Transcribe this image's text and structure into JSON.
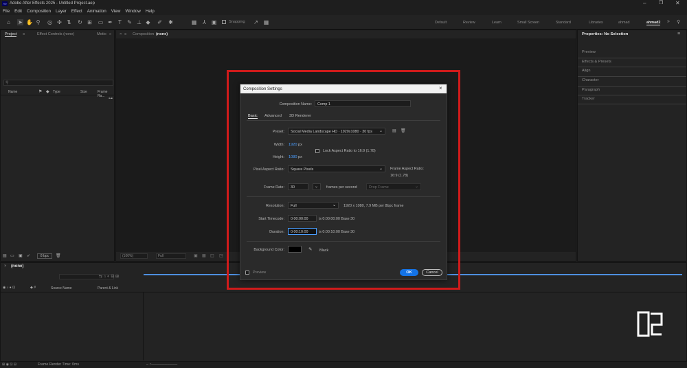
{
  "app": {
    "title": "Adobe After Effects 2025 - Untitled Project.aep",
    "logo": "Ae"
  },
  "menu": [
    "File",
    "Edit",
    "Composition",
    "Layer",
    "Effect",
    "Animation",
    "View",
    "Window",
    "Help"
  ],
  "toolbar": {
    "snapping": "Snapping"
  },
  "workspaces": [
    "Default",
    "Review",
    "Learn",
    "Small Screen",
    "Standard",
    "Libraries",
    "ahmad",
    "ahmad2"
  ],
  "project_panel": {
    "tab_project": "Project",
    "tab_effect_controls": "Effect Controls (none)",
    "tab_motion": "Motio",
    "search_placeholder": "",
    "columns": [
      "Name",
      "Type",
      "Size",
      "Frame Ra..."
    ],
    "bpc": "8 bpc"
  },
  "composition_panel": {
    "tab_label": "Composition",
    "tab_value": "(none)",
    "zoom": "(100%)",
    "resolution": "Full"
  },
  "properties_panel": {
    "title": "Properties: No Selection",
    "items": [
      "Preview",
      "Effects & Presets",
      "Align",
      "Character",
      "Paragraph",
      "Tracker"
    ]
  },
  "timeline": {
    "tab": "(none)",
    "col_source": "Source Name",
    "col_parent": "Parent & Link",
    "status": "Frame Render Time: 0ms"
  },
  "dialog": {
    "title": "Composition Settings",
    "comp_name_label": "Composition Name:",
    "comp_name": "Comp 1",
    "tabs": [
      "Basic",
      "Advanced",
      "3D Renderer"
    ],
    "preset_label": "Preset:",
    "preset": "Social Media Landscape HD · 1920x1080 · 30 fps",
    "width_label": "Width:",
    "width": "1920",
    "height_label": "Height:",
    "height": "1080",
    "px": "px",
    "lock_aspect": "Lock Aspect Ratio to 16:9 (1.78)",
    "par_label": "Pixel Aspect Ratio:",
    "par": "Square Pixels",
    "frame_aspect_label": "Frame Aspect Ratio:",
    "frame_aspect": "16:9 (1.78)",
    "frame_rate_label": "Frame Rate:",
    "frame_rate": "30",
    "fps_text": "frames per second",
    "drop_frame": "Drop Frame",
    "resolution_label": "Resolution:",
    "resolution": "Full",
    "resolution_info": "1920 x 1080, 7.9 MB per 8bpc frame",
    "start_tc_label": "Start Timecode:",
    "start_tc": "0:00:00:00",
    "start_tc_info": "is 0:00:00:00  Base 30",
    "duration_label": "Duration:",
    "duration": "0:00:10:00",
    "duration_info": "is 0:00:10:00  Base 30",
    "bg_label": "Background Color:",
    "bg_name": "Black",
    "preview_label": "Preview",
    "ok": "OK",
    "cancel": "Cancel",
    "colors": {
      "accent": "#1473e6",
      "highlight": "#d01b1b",
      "link": "#4a9eff"
    }
  }
}
